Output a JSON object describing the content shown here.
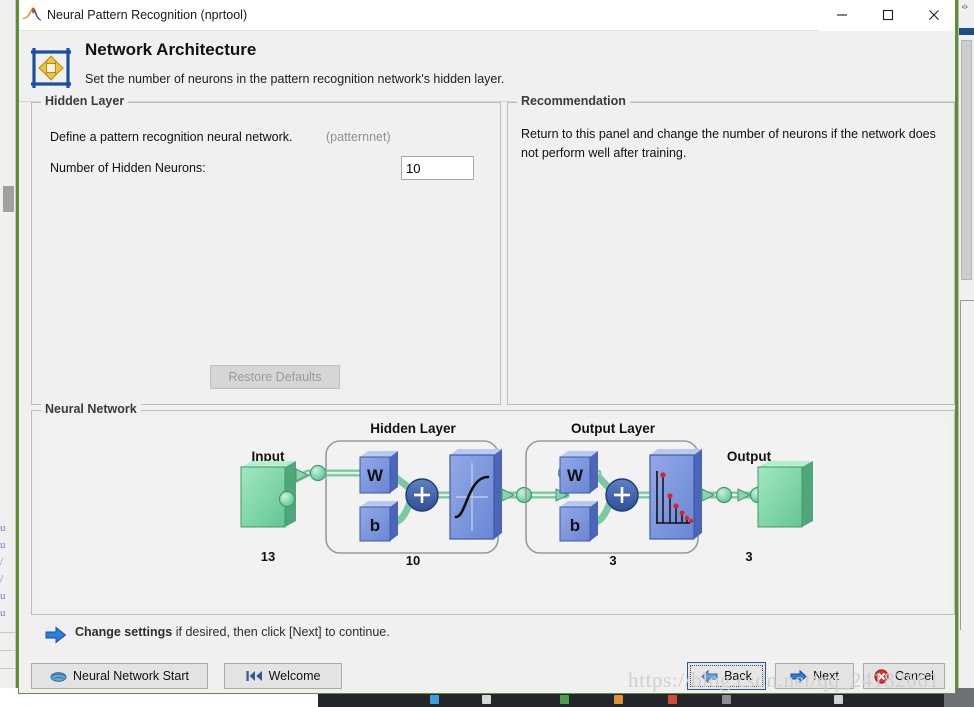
{
  "window": {
    "title": "Neural Pattern Recognition (nprtool)",
    "app_icon": "matlab-logo-icon",
    "minimize_label": "—",
    "maximize_label": "□",
    "close_label": "✕"
  },
  "header": {
    "icon": "network-architecture-icon",
    "title": "Network Architecture",
    "subtitle": "Set the number of neurons in the pattern recognition network's hidden layer."
  },
  "hidden_layer_panel": {
    "legend": "Hidden Layer",
    "description": "Define a pattern recognition neural network.",
    "function_name": "(patternnet)",
    "neurons_label": "Number of Hidden Neurons:",
    "neurons_value": "10",
    "restore_defaults_label": "Restore Defaults",
    "restore_defaults_enabled": false
  },
  "recommendation_panel": {
    "legend": "Recommendation",
    "text": "Return to this panel and change the number of neurons if the network does not perform well after training."
  },
  "network_panel": {
    "legend": "Neural Network",
    "input_label": "Input",
    "input_size": "13",
    "hidden_layer_title": "Hidden Layer",
    "hidden_layer_size": "10",
    "hidden_weight_label": "W",
    "hidden_bias_label": "b",
    "hidden_sum_label": "+",
    "hidden_transfer_icon": "sigmoid-transfer-icon",
    "output_layer_title": "Output Layer",
    "output_layer_size": "3",
    "output_weight_label": "W",
    "output_bias_label": "b",
    "output_sum_label": "+",
    "output_transfer_icon": "softmax-transfer-icon",
    "output_label": "Output",
    "output_size": "3"
  },
  "footer": {
    "hint_icon": "blue-right-arrow-icon",
    "hint_bold": "Change settings",
    "hint_rest": " if desired, then click [Next] to continue.",
    "neural_network_start_label": "Neural Network Start",
    "neural_network_start_icon": "brain-icon",
    "welcome_label": "Welcome",
    "welcome_icon": "skip-to-start-icon",
    "back_label": "Back",
    "back_icon": "arrow-left-icon",
    "next_label": "Next",
    "next_icon": "arrow-right-icon",
    "cancel_label": "Cancel",
    "cancel_icon": "error-x-icon"
  },
  "watermark": {
    "text": "https://blog.csdn.net/qq_24182661"
  },
  "colors": {
    "dialog_bg": "#f0f0f0",
    "window_border_green": "#63903a",
    "input_green": "#7fd6a7",
    "layer_blue": "#7b96e0",
    "sum_circle": "#3c5ea8",
    "arrow_green": "#8bd3a8",
    "focus_blue": "#2b5797",
    "disabled_text": "#9a9a9a",
    "hint_arrow_blue": "#1f6fd0"
  },
  "background_code_lines": [
    "u",
    "u",
    "/",
    "/",
    "u",
    "u"
  ]
}
